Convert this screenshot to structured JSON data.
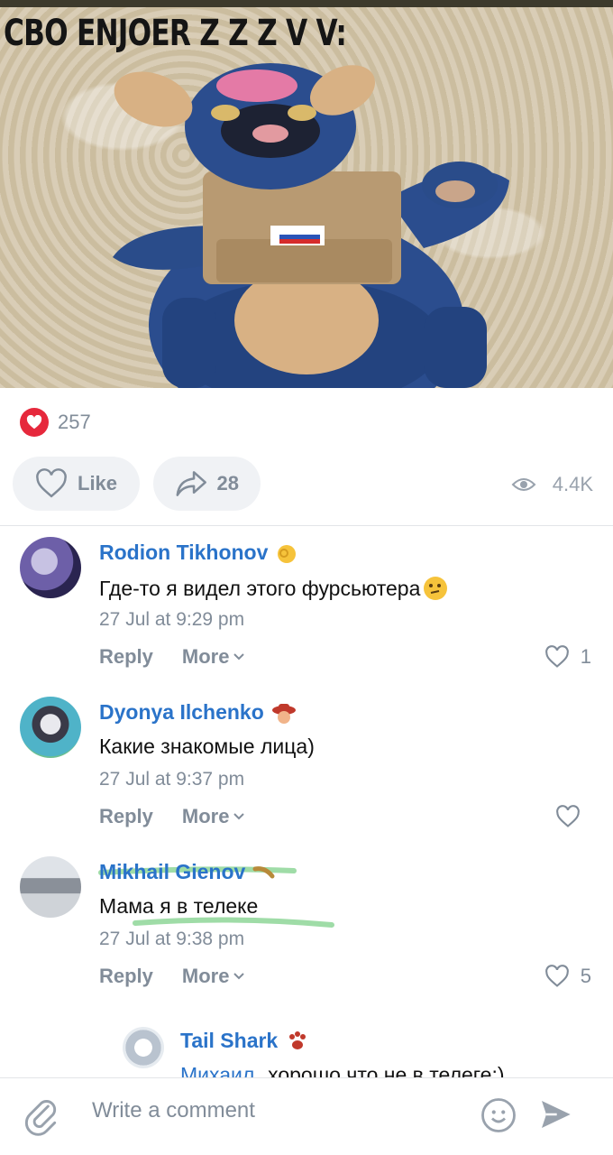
{
  "post": {
    "caption": "CBO ENJOER Z Z Z V V:"
  },
  "reactions": {
    "count": "257"
  },
  "actions": {
    "like_label": "Like",
    "share_count": "28",
    "views_count": "4.4K"
  },
  "comments": [
    {
      "author": "Rodion Tikhonov",
      "text": "Где-то я видел этого фурсьютера",
      "date": "27 Jul at 9:29 pm",
      "reply_label": "Reply",
      "more_label": "More",
      "likes": "1"
    },
    {
      "author": "Dyonya Ilchenko",
      "text": "Какие знакомые лица)",
      "date": "27 Jul at 9:37 pm",
      "reply_label": "Reply",
      "more_label": "More",
      "likes": ""
    },
    {
      "author": "Mikhail Gienov",
      "text": "Мама я в телеке",
      "date": "27 Jul at 9:38 pm",
      "reply_label": "Reply",
      "more_label": "More",
      "likes": "5"
    }
  ],
  "reply": {
    "author": "Tail Shark",
    "text_mention": "Михаил",
    "text": ", хорошо что не в телеге:)"
  },
  "composer": {
    "placeholder": "Write a comment"
  },
  "colors": {
    "accent_link": "#2a73c9",
    "like_red": "#e6283c",
    "secondary_text": "#818c99"
  }
}
